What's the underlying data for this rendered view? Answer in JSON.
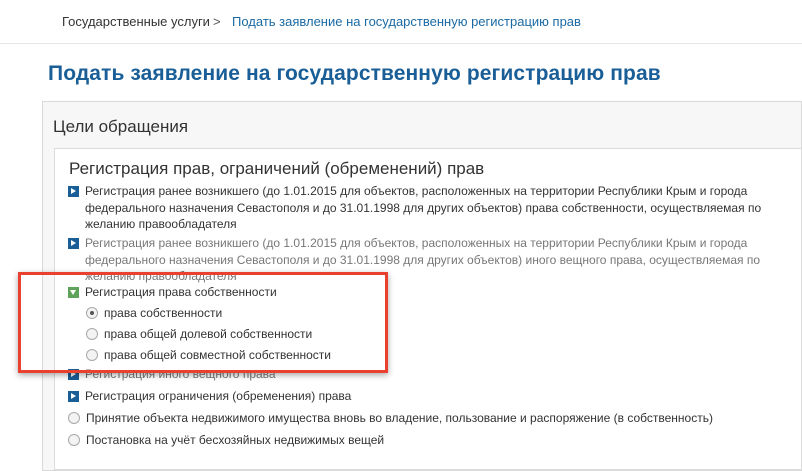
{
  "breadcrumb": {
    "root": "Государственные услуги",
    "separator": ">",
    "current": "Подать заявление на государственную регистрацию прав"
  },
  "page_title": "Подать заявление на государственную регистрацию прав",
  "panel": {
    "title": "Цели обращения",
    "section_title": "Регистрация прав, ограничений (обременений) прав",
    "items": [
      {
        "label": "Регистрация ранее возникшего (до 1.01.2015 для объектов, расположенных на территории Республики Крым и города федерального назначения Севастополя и до 31.01.1998 для других объектов) права собственности, осуществляемая по желанию правообладателя",
        "state": "collapsed"
      },
      {
        "label": "Регистрация ранее возникшего (до 1.01.2015 для объектов, расположенных на территории Республики Крым и города федерального назначения Севастополя и до 31.01.1998 для других объектов) иного вещного права, осуществляемая по желанию правообладателя",
        "state": "collapsed"
      },
      {
        "label": "Регистрация права собственности",
        "state": "expanded",
        "options": [
          {
            "label": "права собственности",
            "checked": true
          },
          {
            "label": "права общей долевой собственности",
            "checked": false
          },
          {
            "label": "права общей совместной собственности",
            "checked": false
          }
        ]
      },
      {
        "label": "Регистрация иного вещного права",
        "state": "collapsed"
      },
      {
        "label": "Регистрация ограничения (обременения) права",
        "state": "collapsed"
      }
    ],
    "radio_items": [
      {
        "label": "Принятие объекта недвижимого имущества вновь во владение, пользование и распоряжение (в собственность)",
        "checked": false
      },
      {
        "label": "Постановка на учёт бесхозяйных недвижимых вещей",
        "checked": false
      }
    ]
  },
  "colors": {
    "title_blue": "#1a5e97",
    "link_blue": "#1a6aa5",
    "expanded_green": "#5fa35a",
    "annotation_red": "#e9412e"
  }
}
